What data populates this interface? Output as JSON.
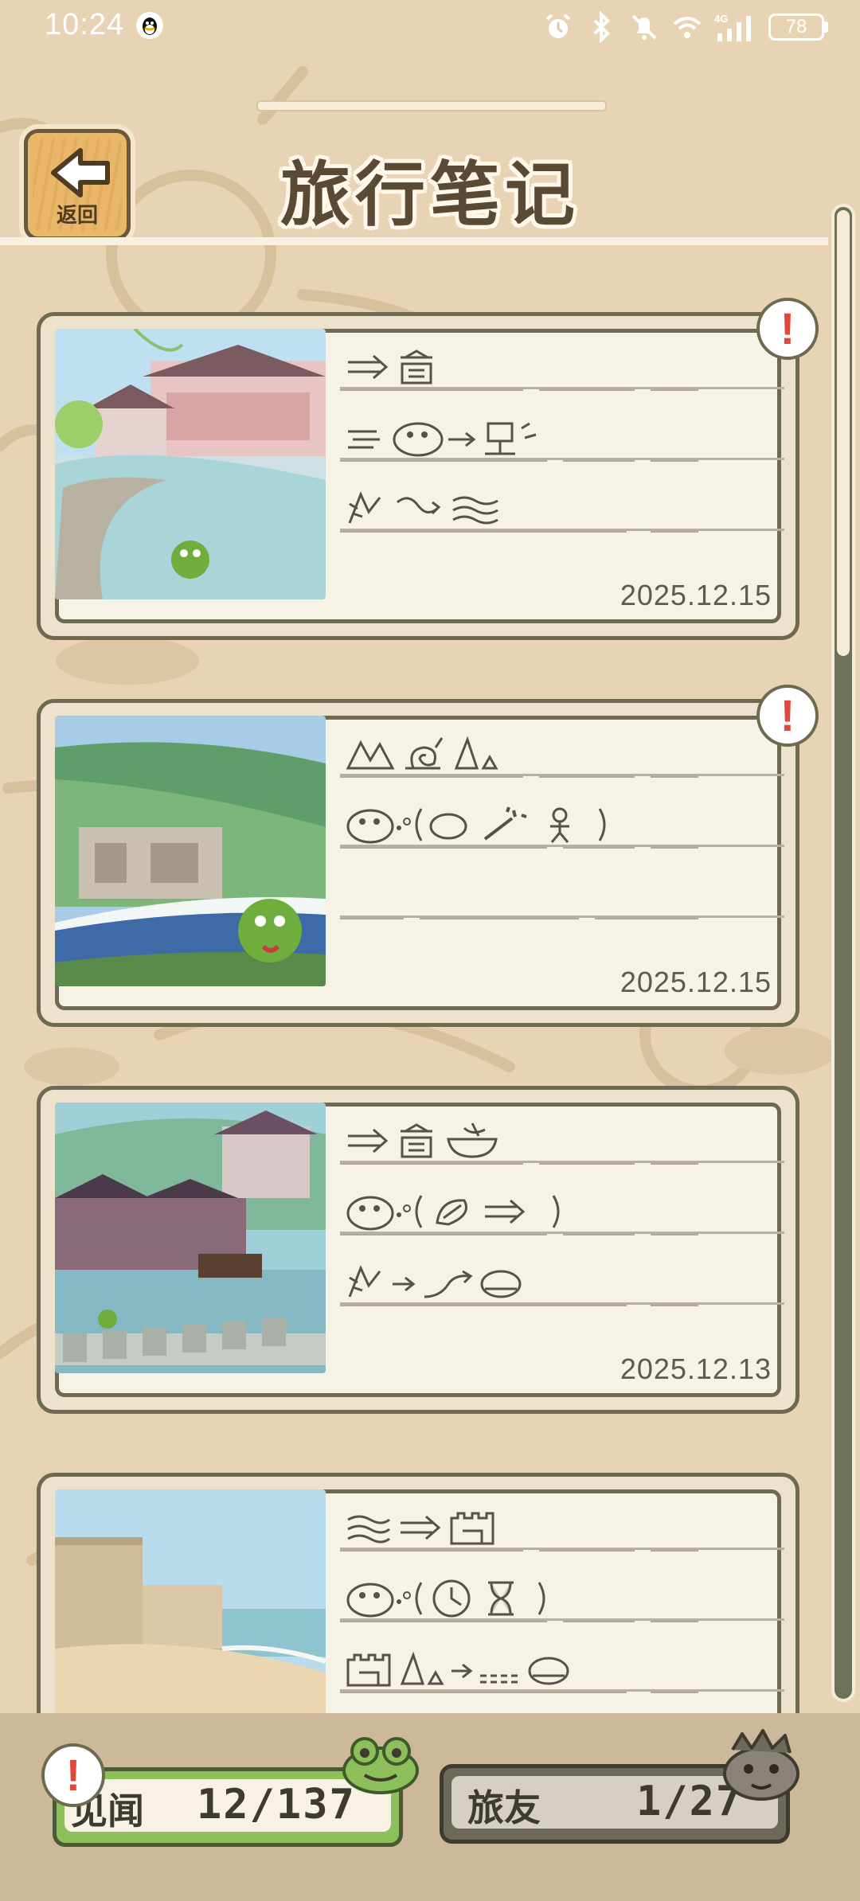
{
  "status_bar": {
    "time": "10:24",
    "battery": "78",
    "icons": [
      "qq-icon",
      "alarm-icon",
      "bluetooth-icon",
      "mute-icon",
      "wifi-icon",
      "signal-4g-icon",
      "battery-icon"
    ]
  },
  "header": {
    "back_label": "返回",
    "title": "旅行笔记"
  },
  "notes": [
    {
      "date": "2025.12.15",
      "has_alert": true,
      "photo": "pavilion-lake-scene"
    },
    {
      "date": "2025.12.15",
      "has_alert": true,
      "photo": "grottoes-river-scene"
    },
    {
      "date": "2025.12.13",
      "has_alert": false,
      "photo": "ancient-town-river-scene"
    },
    {
      "date": "",
      "has_alert": false,
      "photo": "fortress-beach-scene"
    }
  ],
  "alert_symbol": "!",
  "bottom": {
    "seen_label": "见闻",
    "seen_value": "12/137",
    "friends_label": "旅友",
    "friends_value": "1/27"
  },
  "colors": {
    "background": "#e8d4b4",
    "card_border": "#6e6a52",
    "paper": "#f7f2e6",
    "alert": "#e0483e",
    "seen_green": "#8dc05a"
  }
}
